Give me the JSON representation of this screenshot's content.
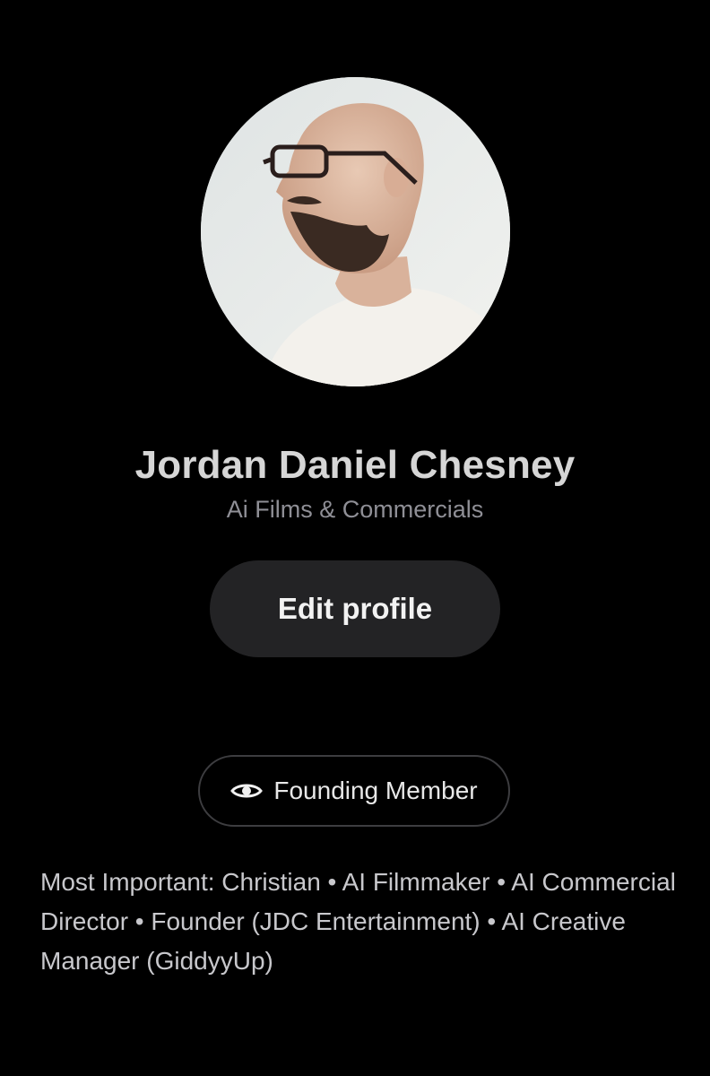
{
  "profile": {
    "name": "Jordan Daniel Chesney",
    "tagline": "Ai Films & Commercials",
    "avatar_icon": "profile-photo",
    "edit_label": "Edit profile"
  },
  "badge": {
    "icon": "eye-icon",
    "label": "Founding Member"
  },
  "bio": {
    "text": "Most Important: Christian • AI Filmmaker • AI Commercial Director • Founder (JDC Entertainment) • AI Creative Manager (GiddyyUp)"
  },
  "colors": {
    "background": "#000000",
    "button_bg": "#232325",
    "name_text": "#d6d6d6",
    "tagline_text": "#8f8f96",
    "badge_border": "#3d3d40"
  }
}
